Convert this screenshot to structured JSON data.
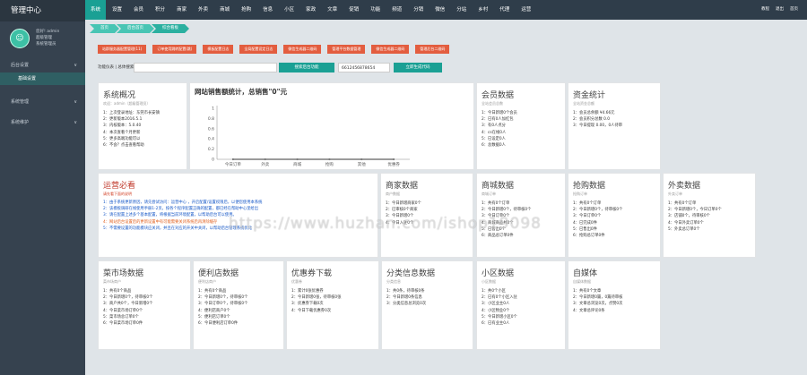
{
  "sidebar": {
    "title": "管理中心",
    "avatar_glyph": "☺",
    "user_lines": [
      "您好! admin",
      "超级管理",
      "系统管理员"
    ],
    "menus": [
      {
        "label": "后台设置"
      },
      {
        "label": "系统管理"
      },
      {
        "label": "系统维护"
      }
    ],
    "active_sub": "基础设置"
  },
  "topnav": {
    "items": [
      "系统",
      "设置",
      "会员",
      "积分",
      "商家",
      "外卖",
      "商城",
      "抢购",
      "信息",
      "小区",
      "家政",
      "文章",
      "促销",
      "功能",
      "频道",
      "分销",
      "微信",
      "分站",
      "乡村",
      "代理",
      "运营"
    ],
    "active": "系统",
    "links": [
      "教程",
      "退出",
      "首页"
    ]
  },
  "crumbs": [
    "首页",
    "后台首页",
    "综合看板"
  ],
  "red_buttons": [
    "站群服务器配置管理(11)",
    "订单使用跳转配置(跳)",
    "模板配置日志",
    "全局配置设定日志",
    "微信生成器二维码",
    "管理平台数据管理",
    "微信生成器二维码",
    "管理后台二维码"
  ],
  "ops": {
    "label": "功能仪表 | 总体搜索：",
    "button": "搜索后台功能",
    "value": "6612456878654",
    "button2": "立即生成代码"
  },
  "cards": {
    "sysinfo": {
      "title": "系统概况",
      "sub": "欢迎：admin（超级管理员）",
      "lines": [
        "1：上次登录地址：东莞市长安镇",
        "2：更新版本2016.5.1",
        "3：内核版本：5.0.40",
        "4：本次查看个月更新",
        "5：更多高端功能可以",
        "6：不会？点击查看帮助"
      ]
    },
    "chart": {
      "title": "网站销售额统计，总销售\"0\"元"
    },
    "member": {
      "title": "会员数据",
      "sub": "全站会员总数",
      "lines": [
        "1：今日新增0个会员",
        "2：已有0人加红包",
        "3：有0人点分",
        "4：cs在线0人",
        "5：已设定0人",
        "6：总数据0人"
      ]
    },
    "finance": {
      "title": "资金统计",
      "sub": "全站资金总额",
      "lines": [
        "1：会员总余额 ¥4.66元",
        "2：会员积分总数 0.0",
        "3：今日提现 0.00，0人待审"
      ]
    },
    "notice": {
      "title": "运营必看",
      "subtitle": "请先看下面的说明",
      "lines": [
        "1：由于系统更新原因，请先尝试访问：运营中心 ，开启配置/设置权限后，以便您使用本系统",
        "2：该模板调研在线使用手册1-2页，按各个程序配置正确的配置，都已经在帮助中心里给出",
        "3：请在配置上述多个基本配置，将根据当前环境配置，以帮助后台可以使用。",
        "4：网站后台设置后的更新设置中有可能需要关闭系统后再清除缓存",
        "5：不需要设置的功能模块应关闭，并且在对应的开关中关闭，以帮助后台管理系统优化"
      ]
    },
    "merchant": {
      "title": "商家数据",
      "sub": "商户数据",
      "lines": [
        "1：今日新增商家0个",
        "2：已审核0个商家",
        "3：今日新增0个",
        "4：今日入驻0个"
      ]
    },
    "mall": {
      "title": "商城数据",
      "sub": "商城订单",
      "lines": [
        "1：共有0个订单",
        "2：今日新增0个，待审核0个",
        "3：今日订单0个",
        "4：商城商品共0个",
        "5：已售出0个",
        "6：商品总订单0件"
      ]
    },
    "groupbuy": {
      "title": "抢购数据",
      "sub": "抢购订单",
      "lines": [
        "1：共有0个订单",
        "2：今日新增0个，待审核0个",
        "3：今日订单0个",
        "4：已完成0件",
        "5：已售出0件",
        "6：抢购总订单0件"
      ]
    },
    "takeout": {
      "title": "外卖数据",
      "sub": "外卖订单",
      "lines": [
        "1：共有0个订单",
        "2：今日新增0个，今日订单0个",
        "3：店铺0个，待审核0个",
        "4：今日外卖订单0个",
        "5：外卖总订单0个"
      ]
    },
    "market": {
      "title": "菜市场数据",
      "sub": "菜市场商户",
      "lines": [
        "1：共有0个商品",
        "2：今日新增0个，待审核0个",
        "3：商户共0个，今日新增0个",
        "4：今日菜市场订单0个",
        "5：菜市场总订单0个",
        "6：今日菜市场订单0件"
      ]
    },
    "store": {
      "title": "便利店数据",
      "sub": "便利店商户",
      "lines": [
        "1：共有0个商品",
        "2：今日新增0个，待审核0个",
        "3：今日订单0个，待审核0个",
        "4：便利店商户0个",
        "5：便利店订单0个",
        "6：今日便利店订单0件"
      ]
    },
    "coupon": {
      "title": "优惠券下载",
      "sub": "优惠券",
      "lines": [
        "1：累计0张优惠券",
        "2：今日新增0张，待审核0张",
        "3：优惠券下载0次",
        "4：今日下载优惠券0次"
      ]
    },
    "classified": {
      "title": "分类信息数据",
      "sub": "分类信息",
      "lines": [
        "1：共0条，待审核0条",
        "2：今日新增0条信息",
        "3：分类信息总浏览0次"
      ]
    },
    "community": {
      "title": "小区数据",
      "sub": "小区数据",
      "lines": [
        "1：共0个小区",
        "2：已有0个小区入驻",
        "3：小区业主0人",
        "4：小区物业0个",
        "5：今日新增小区0个",
        "6：已有业主0人"
      ]
    },
    "media": {
      "title": "自媒体",
      "sub": "自媒体数据",
      "lines": [
        "1：共有0个文章",
        "2：今日新增0篇，0篇待审核",
        "3：文章总浏览0次，点赞0次",
        "4：文章总评论0条"
      ]
    }
  },
  "chart_data": {
    "type": "line",
    "title": "网站销售额统计，总销售\"0\"元",
    "categories": [
      "今日订单",
      "外卖",
      "商城",
      "抢购",
      "其他",
      "优惠券"
    ],
    "series": [
      {
        "values": [
          0,
          0,
          0,
          0,
          0,
          0
        ]
      }
    ],
    "ylim": [
      0,
      1
    ],
    "yticks": [
      "1",
      "0.8",
      "0.6",
      "0.4",
      "0.2",
      "0"
    ],
    "line_color": "#7a7a7a"
  },
  "watermark": "https://www.huzhan.com/ishop19098"
}
